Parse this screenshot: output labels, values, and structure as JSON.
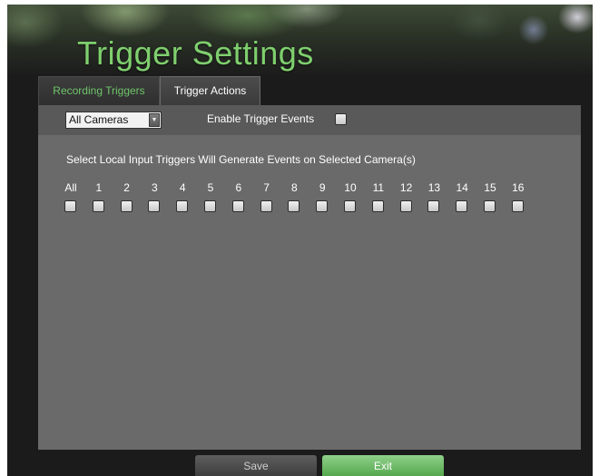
{
  "window": {
    "title": "Trigger Settings"
  },
  "tabs": [
    {
      "label": "Recording Triggers",
      "active": false
    },
    {
      "label": "Trigger Actions",
      "active": true
    }
  ],
  "camera_select": {
    "selected": "All Cameras"
  },
  "enable_trigger": {
    "label": "Enable Trigger Events",
    "checked": false
  },
  "instruction": "Select Local Input Triggers Will Generate Events on Selected Camera(s)",
  "cameras": [
    {
      "label": "All",
      "checked": false
    },
    {
      "label": "1",
      "checked": false
    },
    {
      "label": "2",
      "checked": false
    },
    {
      "label": "3",
      "checked": false
    },
    {
      "label": "4",
      "checked": false
    },
    {
      "label": "5",
      "checked": false
    },
    {
      "label": "6",
      "checked": false
    },
    {
      "label": "7",
      "checked": false
    },
    {
      "label": "8",
      "checked": false
    },
    {
      "label": "9",
      "checked": false
    },
    {
      "label": "10",
      "checked": false
    },
    {
      "label": "11",
      "checked": false
    },
    {
      "label": "12",
      "checked": false
    },
    {
      "label": "13",
      "checked": false
    },
    {
      "label": "14",
      "checked": false
    },
    {
      "label": "15",
      "checked": false
    },
    {
      "label": "16",
      "checked": false
    }
  ],
  "buttons": {
    "save": "Save",
    "exit": "Exit"
  },
  "colors": {
    "accent": "#7fcf6e",
    "exit_button": "#6bbd63",
    "panel": "#6a6a6a"
  }
}
